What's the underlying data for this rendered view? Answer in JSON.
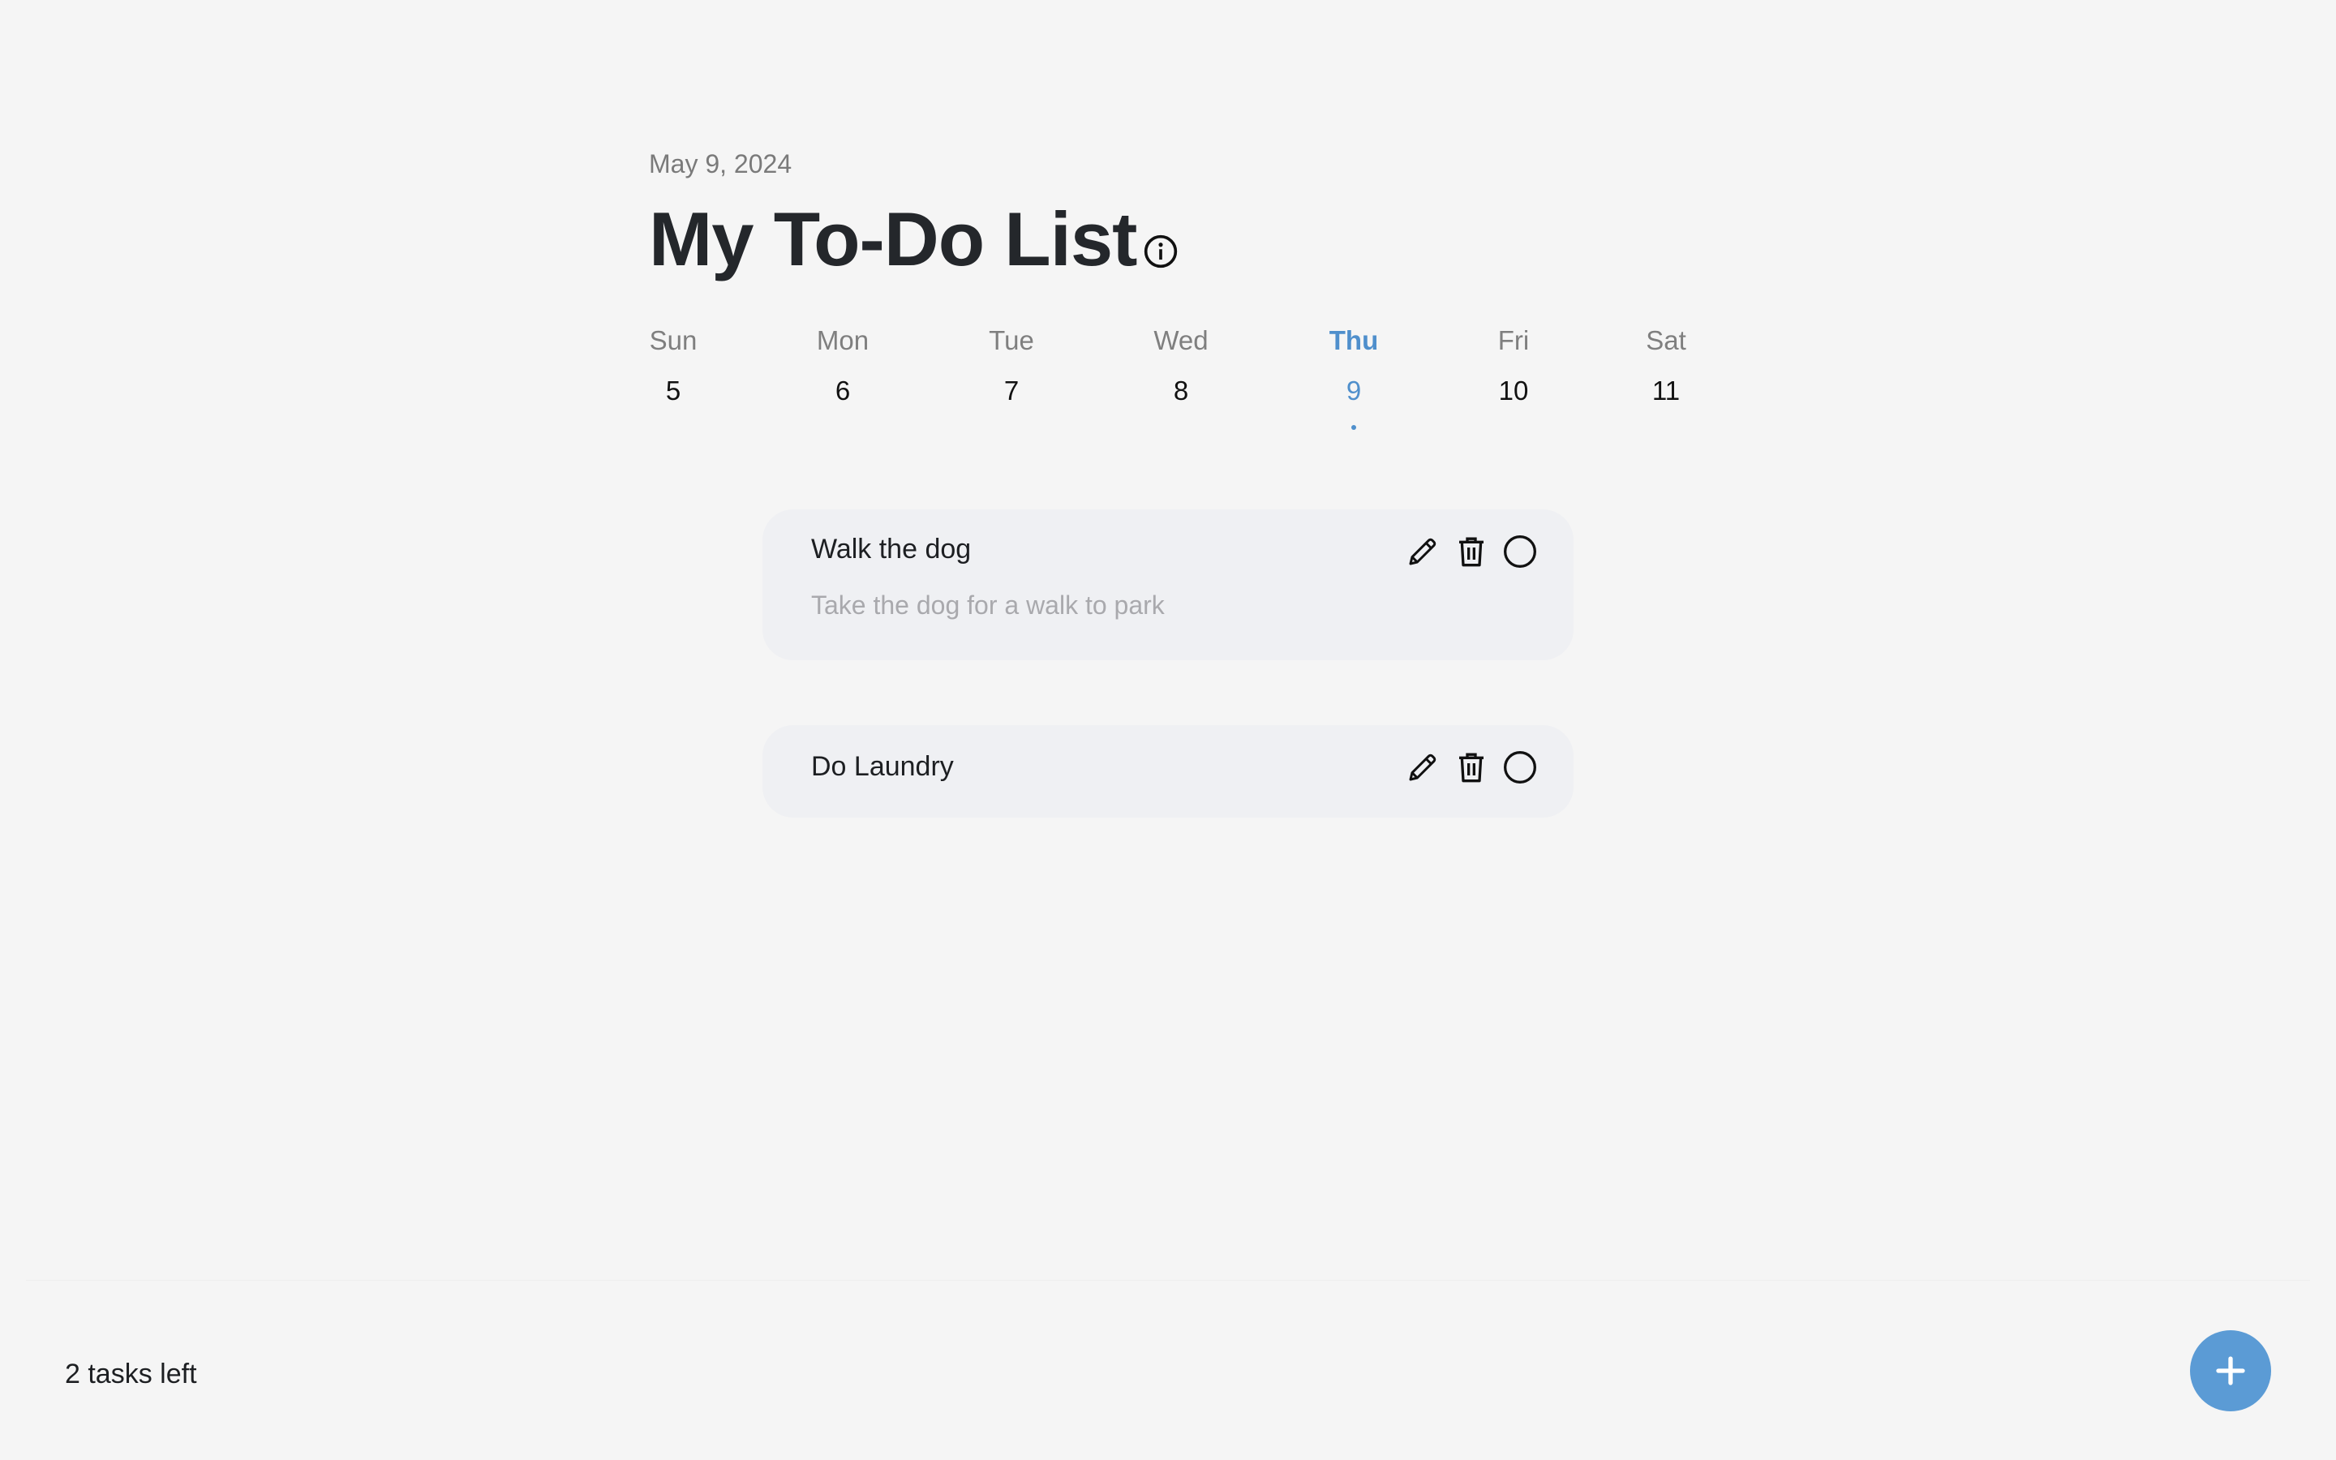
{
  "header": {
    "date": "May 9, 2024",
    "title": "My To-Do List",
    "info_icon": "info-circle-icon"
  },
  "week": {
    "days": [
      {
        "name": "Sun",
        "num": "5"
      },
      {
        "name": "Mon",
        "num": "6"
      },
      {
        "name": "Tue",
        "num": "7"
      },
      {
        "name": "Wed",
        "num": "8"
      },
      {
        "name": "Thu",
        "num": "9",
        "selected": true
      },
      {
        "name": "Fri",
        "num": "10"
      },
      {
        "name": "Sat",
        "num": "11"
      }
    ],
    "accent_color": "#4f8fcc"
  },
  "tasks": [
    {
      "title": "Walk the dog",
      "description": "Take the dog for a walk to park",
      "icons": [
        "pencil-icon",
        "trash-icon",
        "circle-checkbox-icon"
      ]
    },
    {
      "title": "Do Laundry",
      "icons": [
        "pencil-icon",
        "trash-icon",
        "circle-checkbox-icon"
      ]
    }
  ],
  "footer": {
    "tasks_left": "2 tasks left",
    "add_icon": "plus-icon",
    "fab_color": "#5b9bd5"
  }
}
